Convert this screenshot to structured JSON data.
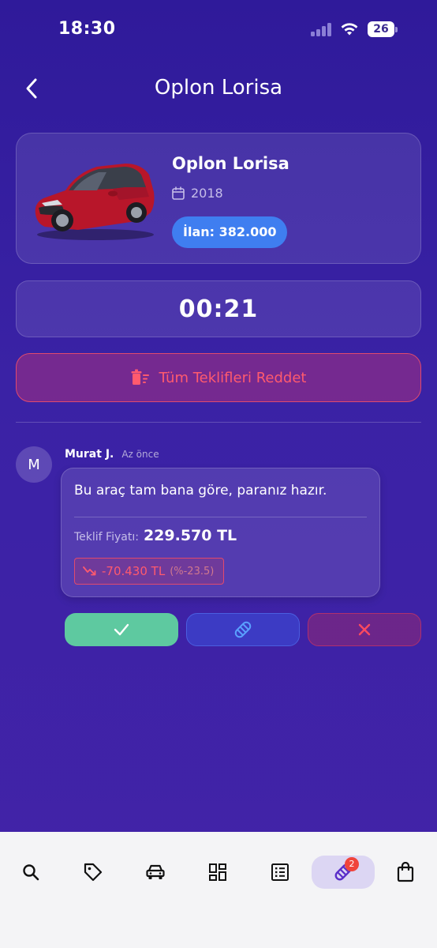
{
  "status_bar": {
    "time": "18:30",
    "battery": "26"
  },
  "header": {
    "title": "Oplon Lorisa"
  },
  "car": {
    "name": "Oplon Lorisa",
    "year": "2018",
    "listing_price": "İlan: 382.000"
  },
  "timer": {
    "value": "00:21"
  },
  "reject_all": {
    "label": "Tüm Teklifleri Reddet"
  },
  "offer": {
    "avatar_initial": "M",
    "sender": "Murat J.",
    "time": "Az önce",
    "message": "Bu araç tam bana göre, paranız hazır.",
    "price_label": "Teklif Fiyatı:",
    "price": "229.570 TL",
    "diff_amount": "-70.430 TL",
    "diff_percent": "(%-23.5)"
  },
  "actions": {
    "accept_icon": "check-icon",
    "counter_icon": "handshake-icon",
    "reject_icon": "close-icon"
  },
  "bottom_nav": {
    "items": [
      "search-icon",
      "tag-icon",
      "car-icon",
      "dashboard-icon",
      "list-icon",
      "handshake-icon",
      "bag-icon"
    ],
    "active_index": 5,
    "badge": "2"
  },
  "colors": {
    "background": "#3a22a5",
    "accent_blue": "#3f7ef0",
    "accept_green": "#5ec9a0",
    "danger_red": "#ff5a6e",
    "active_nav": "#dcd6f3"
  }
}
